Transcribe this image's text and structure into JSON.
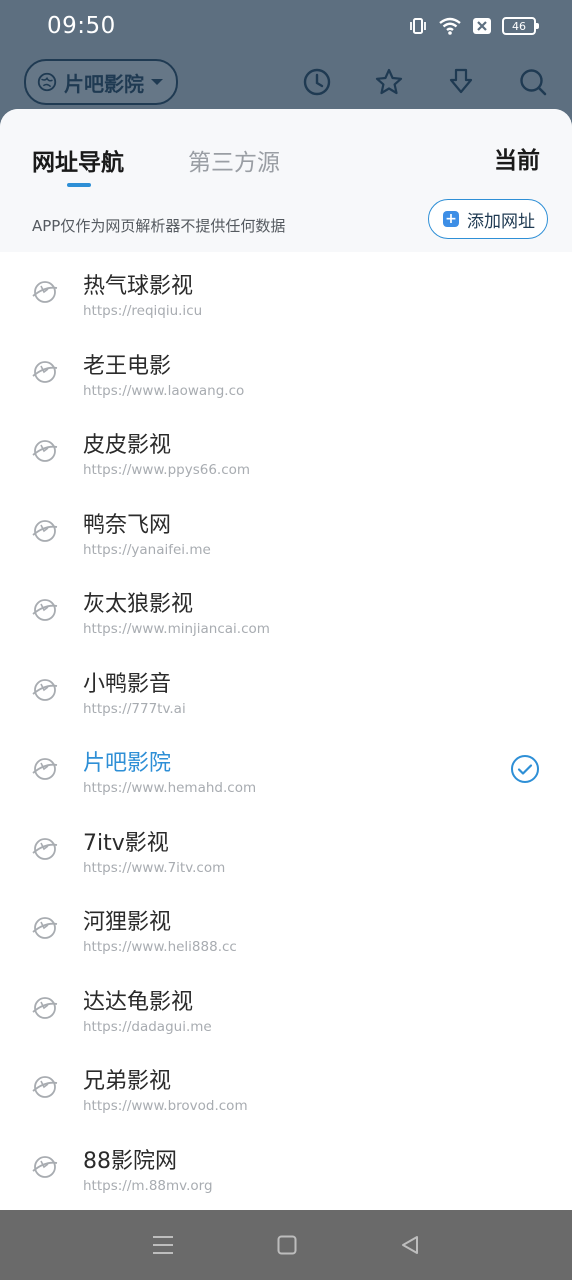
{
  "status": {
    "time": "09:50",
    "battery": "46"
  },
  "header": {
    "source_label": "片吧影院"
  },
  "sheet": {
    "tabs": [
      {
        "label": "网址导航"
      },
      {
        "label": "第三方源"
      }
    ],
    "current_label": "当前",
    "disclaimer": "APP仅作为网页解析器不提供任何数据",
    "add_label": "添加网址",
    "sites": [
      {
        "name": "热气球影视",
        "url": "https://reqiqiu.icu"
      },
      {
        "name": "老王电影",
        "url": "https://www.laowang.co"
      },
      {
        "name": "皮皮影视",
        "url": "https://www.ppys66.com"
      },
      {
        "name": "鸭奈飞网",
        "url": "https://yanaifei.me"
      },
      {
        "name": "灰太狼影视",
        "url": "https://www.minjiancai.com"
      },
      {
        "name": "小鸭影音",
        "url": "https://777tv.ai"
      },
      {
        "name": "片吧影院",
        "url": "https://www.hemahd.com"
      },
      {
        "name": "7itv影视",
        "url": "https://www.7itv.com"
      },
      {
        "name": "河狸影视",
        "url": "https://www.heli888.cc"
      },
      {
        "name": "达达龟影视",
        "url": "https://dadagui.me"
      },
      {
        "name": "兄弟影视",
        "url": "https://www.brovod.com"
      },
      {
        "name": "88影院网",
        "url": "https://m.88mv.org"
      }
    ]
  },
  "colors": {
    "accent": "#2e8fd6",
    "header_bg": "#5d6f80",
    "nav_bg": "#6a6a6a"
  }
}
